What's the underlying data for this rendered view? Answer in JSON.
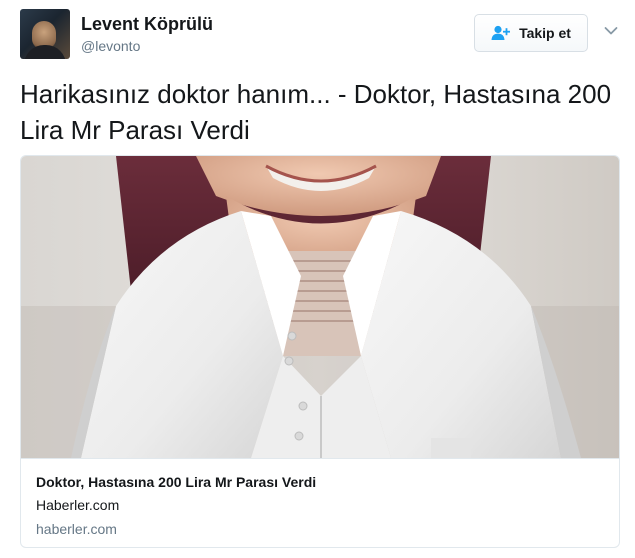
{
  "user": {
    "display_name": "Levent Köprülü",
    "username": "@levonto"
  },
  "actions": {
    "follow_label": "Takip et",
    "follow_icon": "add-user-icon",
    "more_icon": "chevron-down-icon"
  },
  "tweet": {
    "text": "Harikasınız doktor hanım... - Doktor, Hastasına 200 Lira Mr Parası Verdi"
  },
  "card": {
    "title": "Doktor, Hastasına 200 Lira Mr Parası Verdi",
    "description": "Haberler.com",
    "domain": "haberler.com"
  },
  "colors": {
    "primary_text": "#14171a",
    "secondary_text": "#657786",
    "border": "#e1e8ed",
    "accent": "#1da1f2"
  }
}
